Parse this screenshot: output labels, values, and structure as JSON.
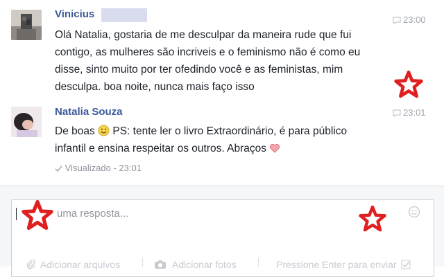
{
  "messages": [
    {
      "sender": "Vinicius",
      "time": "23:00",
      "lines": [
        "Olá Natalia, gostaria de me desculpar da maneira rude que fui",
        "contigo, as mulheres são incriveis e o feminismo não é como eu",
        "disse, sinto muito por ter ofedindo você e as feministas, mim",
        "desculpa. boa noite, nunca mais faço isso"
      ]
    },
    {
      "sender": "Natalia Souza",
      "time": "23:01",
      "line1_before": "De boas ",
      "line1_after": " PS: tente ler o livro Extraordinário, é para público",
      "line2": "infantil e ensina respeitar os outros. Abraços"
    }
  ],
  "seen": "Visualizado - 23:01",
  "reply": {
    "placeholder": "uma resposta..."
  },
  "toolbar": [
    {
      "label": "Adicionar arquivos",
      "icon": "paperclip-icon"
    },
    {
      "label": "Adicionar fotos",
      "icon": "camera-icon"
    },
    {
      "label": "Pressione Enter para enviar",
      "icon": "checkbox-icon"
    }
  ],
  "colors": {
    "link": "#3b5998",
    "star": "#e02020",
    "heart": "#e8828c"
  }
}
